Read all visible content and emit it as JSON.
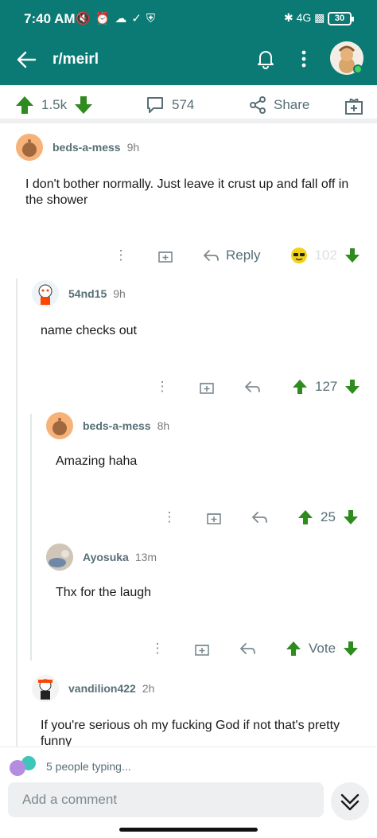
{
  "status_bar": {
    "time": "7:40 AM",
    "battery": "30"
  },
  "header": {
    "title": "r/meirl"
  },
  "post_bar": {
    "votes": "1.5k",
    "comments": "574",
    "share_label": "Share"
  },
  "comments": [
    {
      "user": "beds-a-mess",
      "time": "9h",
      "body": "I don't bother normally. Just leave it crust up and fall off in the shower",
      "reply_label": "Reply",
      "votes": "102"
    },
    {
      "user": "54nd15",
      "time": "9h",
      "body": "name checks out",
      "votes": "127"
    },
    {
      "user": "beds-a-mess",
      "time": "8h",
      "body": "Amazing haha",
      "votes": "25"
    },
    {
      "user": "Ayosuka",
      "time": "13m",
      "body": "Thx for the laugh",
      "votes": "Vote"
    },
    {
      "user": "vandilion422",
      "time": "2h",
      "body": "If you're serious oh my fucking God if not that's pretty funny"
    }
  ],
  "footer": {
    "typing": "5 people typing...",
    "input_placeholder": "Add a comment"
  },
  "colors": {
    "header_bg": "#0b7a74",
    "upvote": "#2e8b1e",
    "downvote": "#2e8b1e",
    "meta_gray": "#576f76"
  },
  "icons": [
    "back-arrow-icon",
    "bell-icon",
    "more-icon",
    "upvote-icon",
    "downvote-icon",
    "comment-icon",
    "share-icon",
    "gift-icon",
    "reply-icon",
    "award-sunglasses-icon",
    "double-chevron-down-icon"
  ]
}
